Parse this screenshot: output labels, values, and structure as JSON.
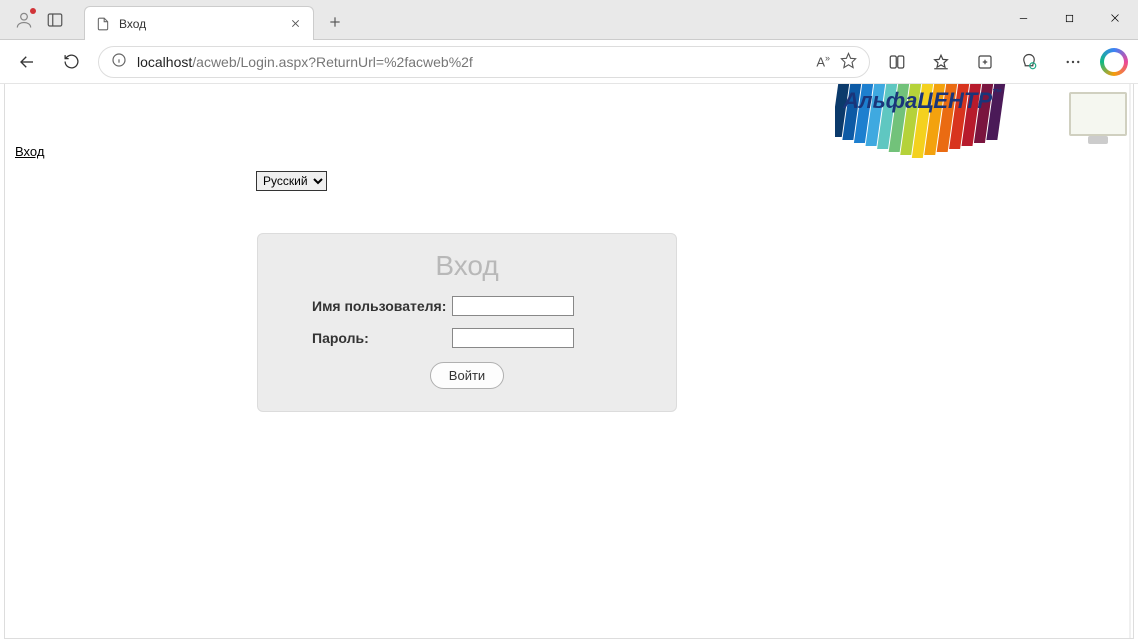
{
  "browser": {
    "tab_title": "Вход",
    "url_host": "localhost",
    "url_path": "/acweb/Login.aspx?ReturnUrl=%2facweb%2f"
  },
  "page": {
    "breadcrumb_login": "Вход",
    "language_selected": "Русский",
    "brand_name": "АльфаЦЕНТР",
    "brand_tm": "™",
    "login_box": {
      "title": "Вход",
      "username_label": "Имя пользователя:",
      "password_label": "Пароль:",
      "username_value": "",
      "password_value": "",
      "submit_label": "Войти"
    }
  },
  "brand_colors": [
    "#0b3a6b",
    "#0d5aa5",
    "#1d7fcf",
    "#3fa9e0",
    "#5fc7c1",
    "#72c27a",
    "#b5d23a",
    "#f4d11e",
    "#f3a20e",
    "#ea6b12",
    "#d8341e",
    "#b71b2c",
    "#7a153f",
    "#4b1a58"
  ]
}
